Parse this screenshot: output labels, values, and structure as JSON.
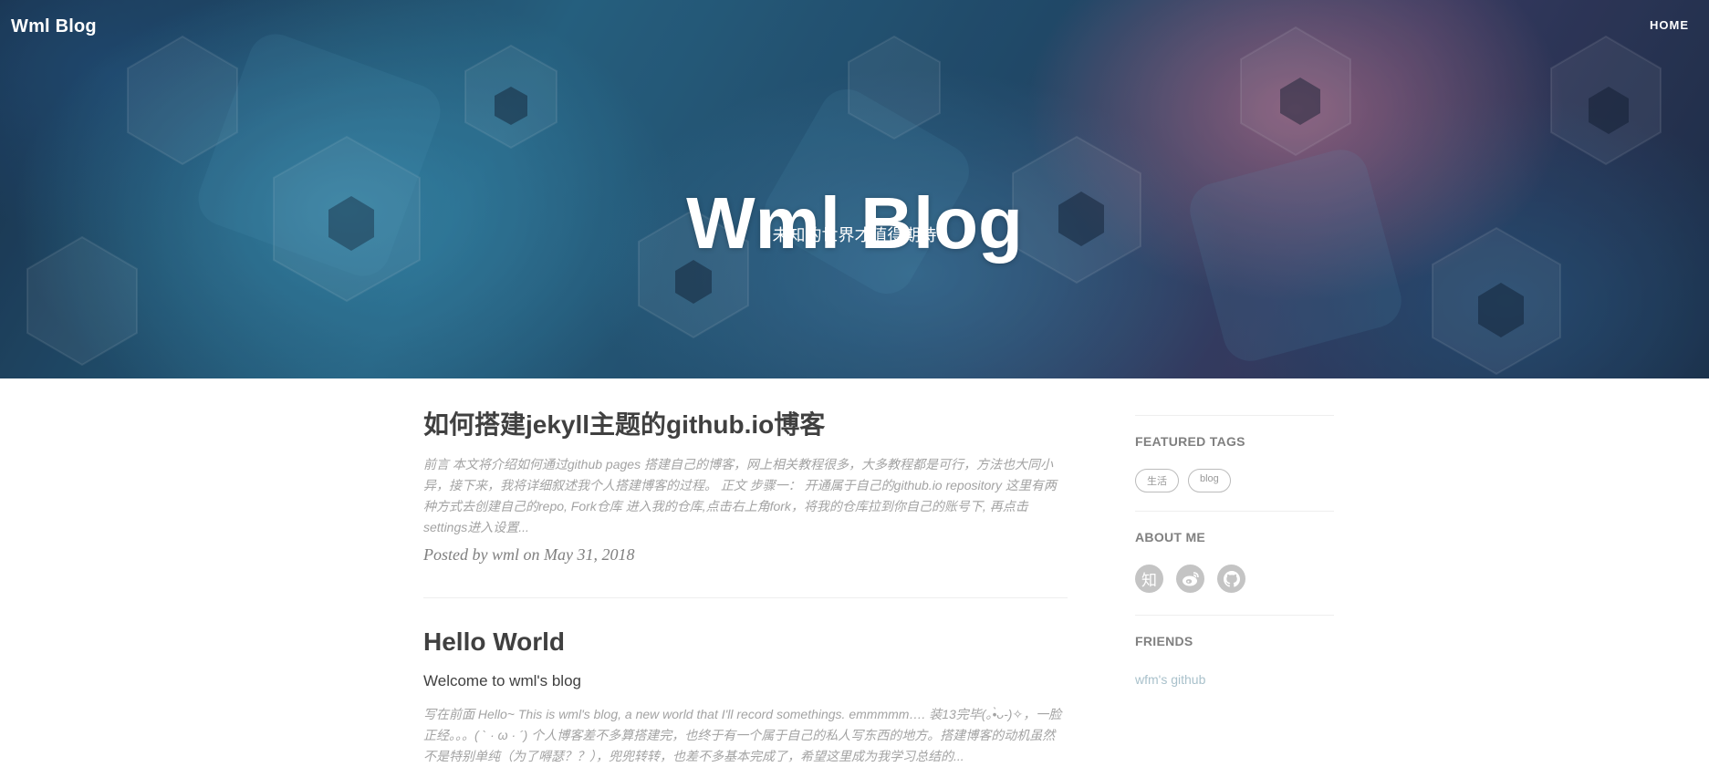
{
  "nav": {
    "brand": "Wml Blog",
    "home": "HOME"
  },
  "hero": {
    "title": "Wml Blog",
    "subtitle": "未知的世界才值得期待"
  },
  "posts": [
    {
      "title": "如何搭建jekyll主题的github.io博客",
      "excerpt": "前言 本文将介绍如何通过github pages 搭建自己的博客，网上相关教程很多，大多教程都是可行，方法也大同小异，接下来，我将详细叙述我个人搭建博客的过程。 正文 步骤一： 开通属于自己的github.io repository 这里有两种方式去创建自己的repo, Fork仓库 进入我的仓库,点击右上角fork，将我的仓库拉到你自己的账号下, 再点击settings进入设置...",
      "meta": "Posted by wml on May 31, 2018"
    },
    {
      "title": "Hello World",
      "subtitle": "Welcome to wml's blog",
      "excerpt": "写在前面 Hello~ This is wml's blog, a new world that I'll record somethings. emmmmm…. 装13完毕(｡•̀ᴗ-)✧，一脸正经。。。( ` · ω · ´) 个人博客差不多算搭建完，也终于有一个属于自己的私人写东西的地方。搭建博客的动机虽然不是特别单纯（为了嘚瑟？？），兜兜转转，也差不多基本完成了，希望这里成为我学习总结的..."
    }
  ],
  "sidebar": {
    "featured_tags": {
      "heading": "FEATURED TAGS",
      "tags": [
        "生活",
        "blog"
      ]
    },
    "about": {
      "heading": "ABOUT ME",
      "icons": [
        "zhihu-icon",
        "weibo-icon",
        "github-icon"
      ],
      "zhihu_glyph": "知"
    },
    "friends": {
      "heading": "FRIENDS",
      "links": [
        "wfm's github"
      ]
    }
  }
}
